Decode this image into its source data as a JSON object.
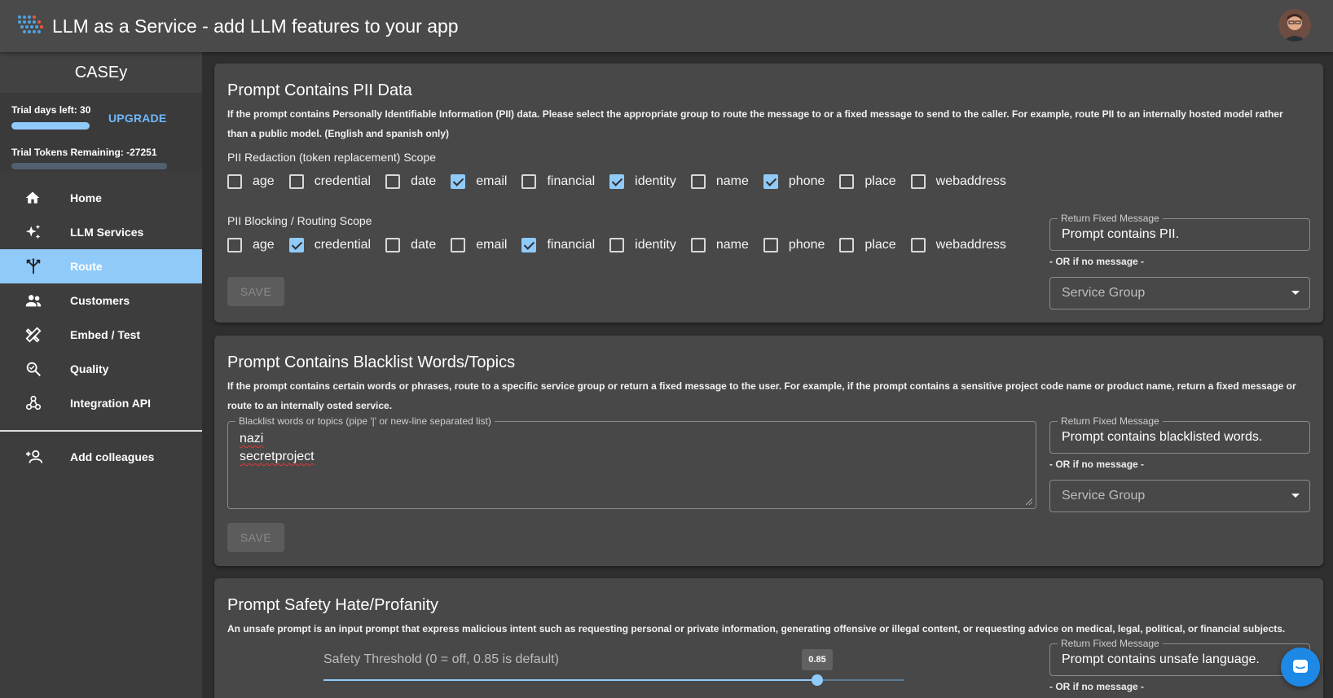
{
  "app": {
    "title": "LLM as a Service - add LLM features to your app"
  },
  "sidebar": {
    "header": "CASEy",
    "trial_days_label": "Trial days left: 30",
    "upgrade_label": "UPGRADE",
    "trial_days_progress_fraction": 0.5,
    "trial_tokens_label": "Trial Tokens Remaining: -27251",
    "nav": [
      {
        "label": "Home",
        "icon": "home-icon"
      },
      {
        "label": "LLM Services",
        "icon": "sparkles-icon"
      },
      {
        "label": "Route",
        "icon": "route-icon",
        "active": true
      },
      {
        "label": "Customers",
        "icon": "people-icon"
      },
      {
        "label": "Embed / Test",
        "icon": "tools-icon"
      },
      {
        "label": "Quality",
        "icon": "quality-search-icon"
      },
      {
        "label": "Integration API",
        "icon": "webhook-icon"
      }
    ],
    "add_colleagues": "Add colleagues"
  },
  "pii": {
    "title": "Prompt Contains PII Data",
    "desc_line1": "If the prompt contains Personally Identifiable Information (PII) data. Please select the appropriate group to route the message to or a fixed message to send to the caller. For example, route PII to an internally hosted model rather",
    "desc_line2": "than a public model. (English and spanish only)",
    "redaction_label": "PII Redaction (token replacement) Scope",
    "redaction": [
      {
        "label": "age",
        "checked": false
      },
      {
        "label": "credential",
        "checked": false
      },
      {
        "label": "date",
        "checked": false
      },
      {
        "label": "email",
        "checked": true
      },
      {
        "label": "financial",
        "checked": false
      },
      {
        "label": "identity",
        "checked": true
      },
      {
        "label": "name",
        "checked": false
      },
      {
        "label": "phone",
        "checked": true
      },
      {
        "label": "place",
        "checked": false
      },
      {
        "label": "webaddress",
        "checked": false
      }
    ],
    "blocking_label": "PII Blocking / Routing Scope",
    "blocking": [
      {
        "label": "age",
        "checked": false
      },
      {
        "label": "credential",
        "checked": true
      },
      {
        "label": "date",
        "checked": false
      },
      {
        "label": "email",
        "checked": false
      },
      {
        "label": "financial",
        "checked": true
      },
      {
        "label": "identity",
        "checked": false
      },
      {
        "label": "name",
        "checked": false
      },
      {
        "label": "phone",
        "checked": false
      },
      {
        "label": "place",
        "checked": false
      },
      {
        "label": "webaddress",
        "checked": false
      }
    ],
    "save": "SAVE",
    "fixed_message_legend": "Return Fixed Message",
    "fixed_message_value": "Prompt contains PII.",
    "or_text": "- OR if no message -",
    "service_group": "Service Group"
  },
  "blacklist": {
    "title": "Prompt Contains Blacklist Words/Topics",
    "desc_line1": "If the prompt contains certain words or phrases, route to a specific service group or return a fixed message to the user. For example, if the prompt contains a sensitive project code name or product name, return a fixed message or",
    "desc_line2": "route to an internally osted service.",
    "words_legend": "Blacklist words or topics (pipe '|' or new-line separated list)",
    "words": [
      "nazi",
      "secretproject"
    ],
    "save": "SAVE",
    "fixed_message_legend": "Return Fixed Message",
    "fixed_message_value": "Prompt contains blacklisted words.",
    "or_text": "- OR if no message -",
    "service_group": "Service Group"
  },
  "safety": {
    "title": "Prompt Safety Hate/Profanity",
    "desc_line1": "An unsafe prompt is an input prompt that express malicious intent such as requesting personal or private information, generating offensive or illegal content, or requesting advice on medical, legal, political, or financial subjects.",
    "slider_label": "Safety Threshold (0 = off, 0.85 is default)",
    "slider_value": "0.85",
    "slider_fraction": 0.85,
    "fixed_message_legend": "Return Fixed Message",
    "fixed_message_value": "Prompt contains unsafe language.",
    "or_text": "- OR if no message -"
  }
}
